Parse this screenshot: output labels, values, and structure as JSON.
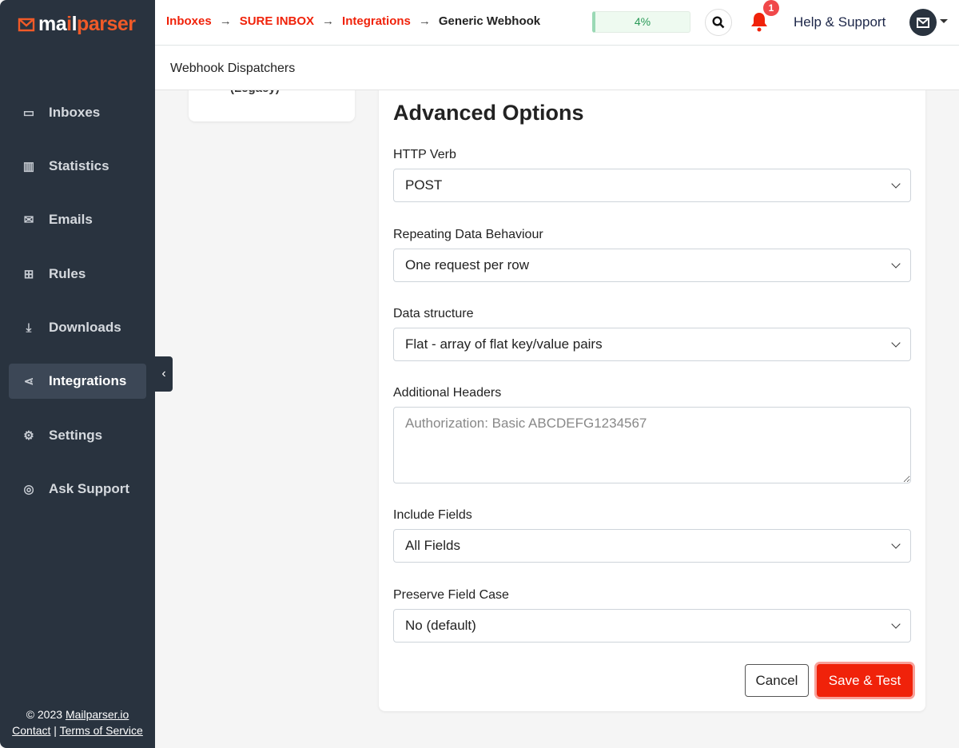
{
  "brand": {
    "logo": "mailparser",
    "accent": "#f0220a"
  },
  "breadcrumb": [
    {
      "label": "Inboxes"
    },
    {
      "label": "SURE INBOX"
    },
    {
      "label": "Integrations"
    },
    {
      "label": "Generic Webhook"
    }
  ],
  "header": {
    "progress": "4%",
    "progress_value": 4,
    "notifications": "1",
    "help": "Help & Support"
  },
  "subheader": "Webhook Dispatchers",
  "left_card_text": "(Legacy)",
  "sidebar": {
    "items": [
      {
        "label": "Inboxes",
        "icon": "inbox-icon"
      },
      {
        "label": "Statistics",
        "icon": "chart-icon"
      },
      {
        "label": "Emails",
        "icon": "envelope-icon"
      },
      {
        "label": "Rules",
        "icon": "sitemap-icon"
      },
      {
        "label": "Downloads",
        "icon": "download-icon"
      },
      {
        "label": "Integrations",
        "icon": "share-icon",
        "active": true
      },
      {
        "label": "Settings",
        "icon": "gear-icon"
      },
      {
        "label": "Ask Support",
        "icon": "lifebuoy-icon"
      }
    ],
    "footer": {
      "copyright": "© 2023 ",
      "site": "Mailparser.io",
      "contact": "Contact",
      "sep": " | ",
      "terms": "Terms of Service"
    }
  },
  "form": {
    "title": "Advanced Options",
    "http_verb": {
      "label": "HTTP Verb",
      "value": "POST"
    },
    "repeating": {
      "label": "Repeating Data Behaviour",
      "value": "One request per row"
    },
    "structure": {
      "label": "Data structure",
      "value": "Flat - array of flat key/value pairs"
    },
    "headers": {
      "label": "Additional Headers",
      "placeholder": "Authorization: Basic ABCDEFG1234567"
    },
    "include": {
      "label": "Include Fields",
      "value": "All Fields"
    },
    "case": {
      "label": "Preserve Field Case",
      "value": "No (default)"
    },
    "cancel": "Cancel",
    "save": "Save & Test"
  }
}
